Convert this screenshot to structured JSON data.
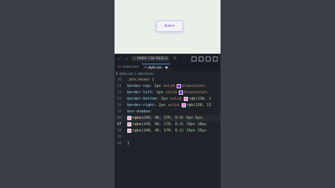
{
  "preview": {
    "button_label": "Button"
  },
  "titlebar": {
    "back": "←",
    "forward": "→",
    "search_label": "DARK CSS REELS",
    "account": "⚇"
  },
  "tabs": [
    {
      "label": "index.html",
      "active": false
    },
    {
      "label": "style.css",
      "active": true
    }
  ],
  "breadcrumb": {
    "file": "style.css",
    "sep": ">",
    "selector": ".btn:hover"
  },
  "editor": {
    "lines": [
      {
        "n": "30",
        "parts": [
          {
            "t": ".btn:hover",
            "c": "sel"
          },
          {
            "t": " {",
            "c": ""
          }
        ]
      },
      {
        "n": "31",
        "parts": [
          {
            "t": "  border-top",
            "c": "prop"
          },
          {
            "t": ": ",
            "c": ""
          },
          {
            "t": "2px",
            "c": "num"
          },
          {
            "t": " solid ",
            "c": "kw"
          },
          {
            "sw": "#8a2be2"
          },
          {
            "t": "blueviolet;",
            "c": "kw"
          }
        ]
      },
      {
        "n": "32",
        "parts": [
          {
            "t": "  border-left",
            "c": "prop"
          },
          {
            "t": ": ",
            "c": ""
          },
          {
            "t": "2px",
            "c": "num"
          },
          {
            "t": " solid ",
            "c": "kw"
          },
          {
            "sw": "#8a2be2"
          },
          {
            "t": "blueviolet;",
            "c": "kw"
          }
        ]
      },
      {
        "n": "33",
        "parts": [
          {
            "t": "  border-bottom",
            "c": "prop"
          },
          {
            "t": ": ",
            "c": ""
          },
          {
            "t": "2px",
            "c": "num"
          },
          {
            "t": " solid ",
            "c": "kw"
          },
          {
            "sw": "#ee82ee"
          },
          {
            "t": "rgb",
            "c": "fn"
          },
          {
            "t": "(238, 1",
            "c": "num"
          }
        ]
      },
      {
        "n": "34",
        "parts": [
          {
            "t": "  border-right",
            "c": "prop"
          },
          {
            "t": ": ",
            "c": ""
          },
          {
            "t": "2px",
            "c": "num"
          },
          {
            "t": " solid ",
            "c": "kw"
          },
          {
            "sw": "#ee82ee"
          },
          {
            "t": "rgb",
            "c": "fn"
          },
          {
            "t": "(238, 13",
            "c": "num"
          }
        ]
      },
      {
        "n": "35",
        "parts": [
          {
            "t": "  box-shadow",
            "c": "prop"
          },
          {
            "t": ":",
            "c": ""
          }
        ]
      },
      {
        "n": "36",
        "parts": [
          {
            "t": "      ",
            "c": ""
          },
          {
            "sw": "#f0aec8"
          },
          {
            "t": "rgba",
            "c": "fn"
          },
          {
            "t": "(240, 46, 170, 0.4) 5px 5px,",
            "c": "num"
          }
        ]
      },
      {
        "n": "37",
        "parts": [
          {
            "t": "      ",
            "c": ""
          },
          {
            "sw": "#f0aec8"
          },
          {
            "t": "rgba",
            "c": "fn"
          },
          {
            "t": "(240, 46, 170, 0.3) 10px 10px",
            "c": "num"
          }
        ]
      },
      {
        "n": "38",
        "parts": [
          {
            "t": "      ",
            "c": ""
          },
          {
            "sw": "#f0aec8"
          },
          {
            "t": "rgba",
            "c": "fn"
          },
          {
            "t": "(240, 46, 170, 0.2) 15px 15px",
            "c": "num"
          }
        ]
      },
      {
        "n": "39",
        "parts": [
          {
            "t": "",
            "c": ""
          }
        ]
      },
      {
        "n": "40",
        "parts": [
          {
            "t": "}",
            "c": ""
          }
        ]
      }
    ],
    "current_line": "37"
  }
}
